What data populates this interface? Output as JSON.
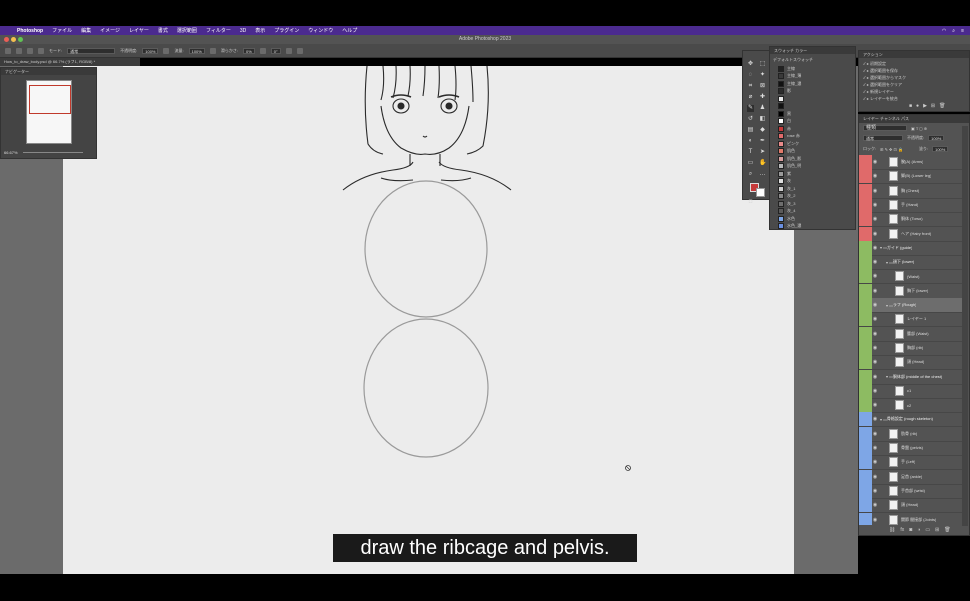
{
  "menubar": {
    "app": "Photoshop",
    "items": [
      "ファイル",
      "編集",
      "イメージ",
      "レイヤー",
      "書式",
      "選択範囲",
      "フィルター",
      "3D",
      "表示",
      "プラグイン",
      "ウィンドウ",
      "ヘルプ"
    ]
  },
  "window": {
    "title": "Adobe Photoshop 2023"
  },
  "options_bar": {
    "mode_label": "モード:",
    "mode_value": "通常",
    "opacity_label": "不透明度:",
    "opacity_value": "100%",
    "flow_label": "流量:",
    "flow_value": "100%",
    "smoothing_label": "滑らかさ:",
    "smoothing_value": "0%",
    "angle_value": "0°"
  },
  "document_tab": {
    "label": "How_to_draw_body.psd @ 66.7% (ラフ1, RGB/8) *"
  },
  "navigator": {
    "title": "ナビゲーター",
    "zoom": "66.67%"
  },
  "swatches": {
    "tabs": "スウォッチ  カラー",
    "group": "デフォルトスウォッチ",
    "rows": [
      {
        "name": "主線",
        "color": "#222222"
      },
      {
        "name": "主線_薄",
        "color": "#3a3a3a"
      },
      {
        "name": "主線_濃",
        "color": "#111111"
      },
      {
        "name": "影",
        "color": "#2b2b2b"
      },
      {
        "name": "",
        "color": "#e8e8e8"
      },
      {
        "name": "",
        "color": "#111111"
      },
      {
        "name": "黒",
        "color": "#000000"
      },
      {
        "name": "白",
        "color": "#ffffff"
      },
      {
        "name": "赤",
        "color": "#c63a3a"
      },
      {
        "name": "rose 赤",
        "color": "#e06a6a"
      },
      {
        "name": "ピンク",
        "color": "#e88a8a"
      },
      {
        "name": "肌色",
        "color": "#e27a6a"
      },
      {
        "name": "肌色_影",
        "color": "#d8a0a0"
      },
      {
        "name": "肌色_明",
        "color": "#b7b7b7"
      },
      {
        "name": "紫",
        "color": "#9a9a9a"
      },
      {
        "name": "灰",
        "color": "#dddddd"
      },
      {
        "name": "灰_1",
        "color": "#cfcfcf"
      },
      {
        "name": "灰_2",
        "color": "#888888"
      },
      {
        "name": "灰_3",
        "color": "#6e6e6e"
      },
      {
        "name": "灰_4",
        "color": "#5a5a5a"
      },
      {
        "name": "水色",
        "color": "#7ea6e6"
      },
      {
        "name": "水色_濃",
        "color": "#6a8fe0"
      }
    ]
  },
  "actions": {
    "title": "アクション",
    "items": [
      "初期設定",
      "選択範囲を保存",
      "選択範囲からマスク",
      "選択範囲をクリア",
      "新規レイヤー",
      "レイヤーを統合"
    ]
  },
  "layers": {
    "tabs": "レイヤー  チャンネル  パス",
    "kind_label": "種類",
    "mode_value": "通常",
    "opacity_label": "不透明度:",
    "opacity_value": "100%",
    "fill_label": "塗り:",
    "fill_value": "100%",
    "lock_label": "ロック:",
    "rows": [
      {
        "name": "腕(A) (Arms)",
        "strip": "#e06a6a",
        "indent": 1,
        "group": false,
        "selected": false
      },
      {
        "name": "脚(B) (Lower leg)",
        "strip": "#e06a6a",
        "indent": 1,
        "group": false,
        "selected": false
      },
      {
        "name": "胸 (Chest)",
        "strip": "#e06a6a",
        "indent": 1,
        "group": false,
        "selected": false
      },
      {
        "name": "手 (Hand)",
        "strip": "#e06a6a",
        "indent": 1,
        "group": false,
        "selected": false
      },
      {
        "name": "胴体 (Torso)",
        "strip": "#e06a6a",
        "indent": 1,
        "group": false,
        "selected": false
      },
      {
        "name": "ヘア (Hairy front)",
        "strip": "#e06a6a",
        "indent": 1,
        "group": false,
        "selected": false
      },
      {
        "name": "ガイド (guide)",
        "strip": "#8dbb62",
        "indent": 0,
        "group": true,
        "selected": false
      },
      {
        "name": "顔下 (lower)",
        "strip": "#8dbb62",
        "indent": 1,
        "group": true,
        "selected": false
      },
      {
        "name": "(Waist)",
        "strip": "#8dbb62",
        "indent": 2,
        "group": false,
        "selected": false
      },
      {
        "name": "胸下 (lower)",
        "strip": "#8dbb62",
        "indent": 2,
        "group": false,
        "selected": false
      },
      {
        "name": "ラフ (Rough)",
        "strip": "#8dbb62",
        "indent": 1,
        "group": true,
        "selected": true
      },
      {
        "name": "レイヤー 1",
        "strip": "#8dbb62",
        "indent": 2,
        "group": false,
        "selected": false
      },
      {
        "name": "腰部 (Waist)",
        "strip": "#8dbb62",
        "indent": 2,
        "group": false,
        "selected": false
      },
      {
        "name": "胸部 (rib)",
        "strip": "#8dbb62",
        "indent": 2,
        "group": false,
        "selected": false
      },
      {
        "name": "頭 (Head)",
        "strip": "#8dbb62",
        "indent": 2,
        "group": false,
        "selected": false
      },
      {
        "name": "胴体部 (middle of the chest)",
        "strip": "#8dbb62",
        "indent": 1,
        "group": true,
        "selected": false
      },
      {
        "name": "c1",
        "strip": "#8dbb62",
        "indent": 2,
        "group": false,
        "selected": false
      },
      {
        "name": "c2",
        "strip": "#8dbb62",
        "indent": 2,
        "group": false,
        "selected": false
      },
      {
        "name": "骨格設定 (rough skeleton)",
        "strip": "#7ea6e6",
        "indent": 0,
        "group": true,
        "selected": false
      },
      {
        "name": "肋骨 (rib)",
        "strip": "#7ea6e6",
        "indent": 1,
        "group": false,
        "selected": false
      },
      {
        "name": "骨盤 (pelvis)",
        "strip": "#7ea6e6",
        "indent": 1,
        "group": false,
        "selected": false
      },
      {
        "name": "手 (Left)",
        "strip": "#7ea6e6",
        "indent": 1,
        "group": false,
        "selected": false
      },
      {
        "name": "足首 (ankle)",
        "strip": "#7ea6e6",
        "indent": 1,
        "group": false,
        "selected": false
      },
      {
        "name": "手首部 (wrist)",
        "strip": "#7ea6e6",
        "indent": 1,
        "group": false,
        "selected": false
      },
      {
        "name": "頭 (Head)",
        "strip": "#7ea6e6",
        "indent": 1,
        "group": false,
        "selected": false
      },
      {
        "name": "関節 間接部 (Joints)",
        "strip": "#7ea6e6",
        "indent": 1,
        "group": false,
        "selected": false
      }
    ]
  },
  "caption": {
    "text": "draw the ribcage and pelvis."
  },
  "colors": {
    "menubar": "#4b2a8f",
    "canvas": "#ececec",
    "workspace": "#6b6b6b",
    "group_red": "#e06a6a",
    "group_green": "#8dbb62",
    "group_blue": "#7ea6e6"
  }
}
